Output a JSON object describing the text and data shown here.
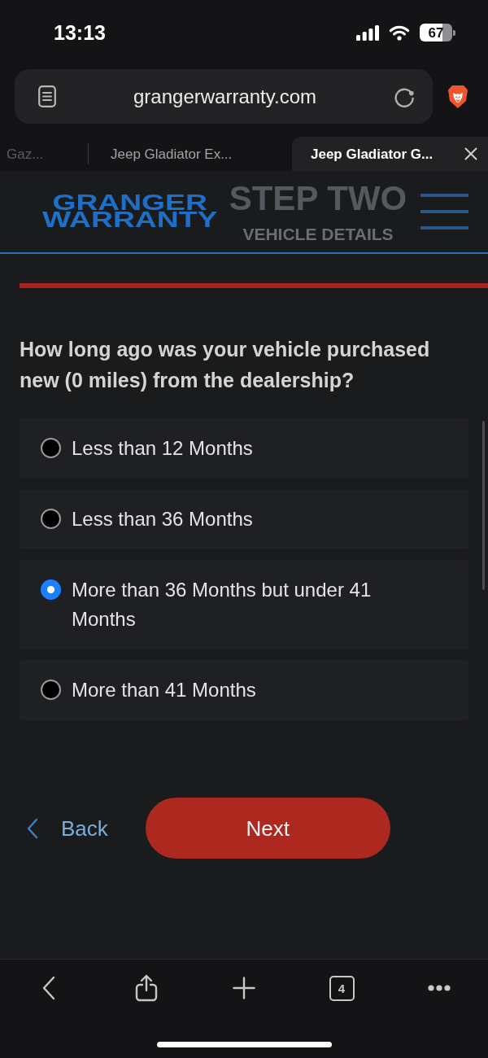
{
  "status_bar": {
    "time": "13:13",
    "battery": "67"
  },
  "browser": {
    "url": "grangerwarranty.com",
    "tabs": [
      {
        "title": "Gaz...",
        "selected": false
      },
      {
        "title": "Jeep Gladiator Ex...",
        "selected": false
      },
      {
        "title": "Jeep Gladiator G...",
        "selected": true
      }
    ]
  },
  "header": {
    "logo": "GRANGER WARRANTY",
    "step_title": "STEP TWO",
    "step_subtitle": "VEHICLE DETAILS"
  },
  "progress": {
    "level": 1
  },
  "question": "How long ago was your vehicle purchased new (0 miles) from the dealership?",
  "options": [
    {
      "label": "Less than 12 Months",
      "selected": false
    },
    {
      "label": "Less than 36 Months",
      "selected": false
    },
    {
      "label": "More than 36 Months but under 41 Months",
      "selected": true
    },
    {
      "label": "More than 41 Months",
      "selected": false
    }
  ],
  "navigation": {
    "back": "Back",
    "next": "Next"
  },
  "toolbar": {
    "tab_count": "4"
  }
}
